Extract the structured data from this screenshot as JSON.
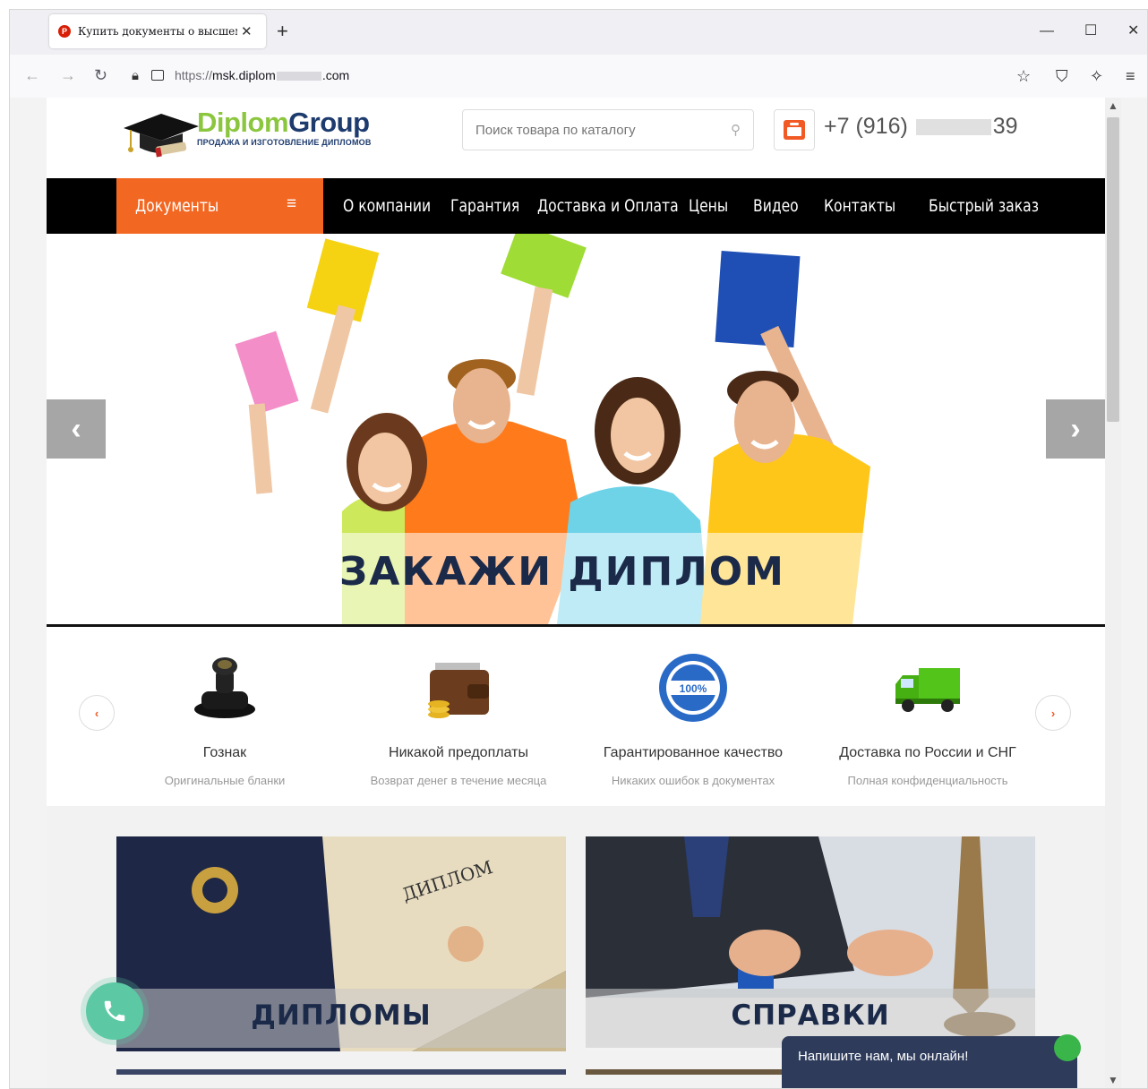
{
  "browser": {
    "tab_title": "Купить документы о высшем о",
    "tab_icon": "P",
    "new_tab": "+",
    "url_proto": "https://",
    "url_host_start": "msk.diplom",
    "url_host_end": ".com",
    "accent": "#f26722"
  },
  "site": {
    "logo": {
      "part1": "Diplom",
      "part2": "Group",
      "tagline": "ПРОДАЖА И ИЗГОТОВЛЕНИЕ ДИПЛОМОВ"
    },
    "search": {
      "placeholder": "Поиск товара по каталогу"
    },
    "phone": {
      "prefix": "+7 (916)",
      "suffix": "39"
    },
    "menu": {
      "documents": "Документы",
      "burger": "≡",
      "items": [
        "О компании",
        "Гарантия",
        "Доставка и Оплата",
        "Цены",
        "Видео",
        "Контакты",
        "Быстрый заказ"
      ]
    },
    "hero": {
      "title": "ЗАКАЖИ ДИПЛОМ",
      "prev": "‹",
      "next": "›"
    },
    "features": [
      {
        "title": "Гознак",
        "subtitle": "Оригинальные бланки",
        "icon": "stamp-icon"
      },
      {
        "title": "Никакой предоплаты",
        "subtitle": "Возврат денег в течение месяца",
        "icon": "wallet-icon"
      },
      {
        "title": "Гарантированное качество",
        "subtitle": "Никаких ошибок в документах",
        "icon": "quality-seal-icon"
      },
      {
        "title": "Доставка по России и СНГ",
        "subtitle": "Полная конфиденциальность",
        "icon": "truck-icon"
      }
    ],
    "features_prev": "‹",
    "features_next": "›",
    "categories": [
      {
        "title": "ДИПЛОМЫ"
      },
      {
        "title": "СПРАВКИ"
      }
    ],
    "chat": {
      "text": "Напишите нам, мы онлайн!"
    }
  }
}
